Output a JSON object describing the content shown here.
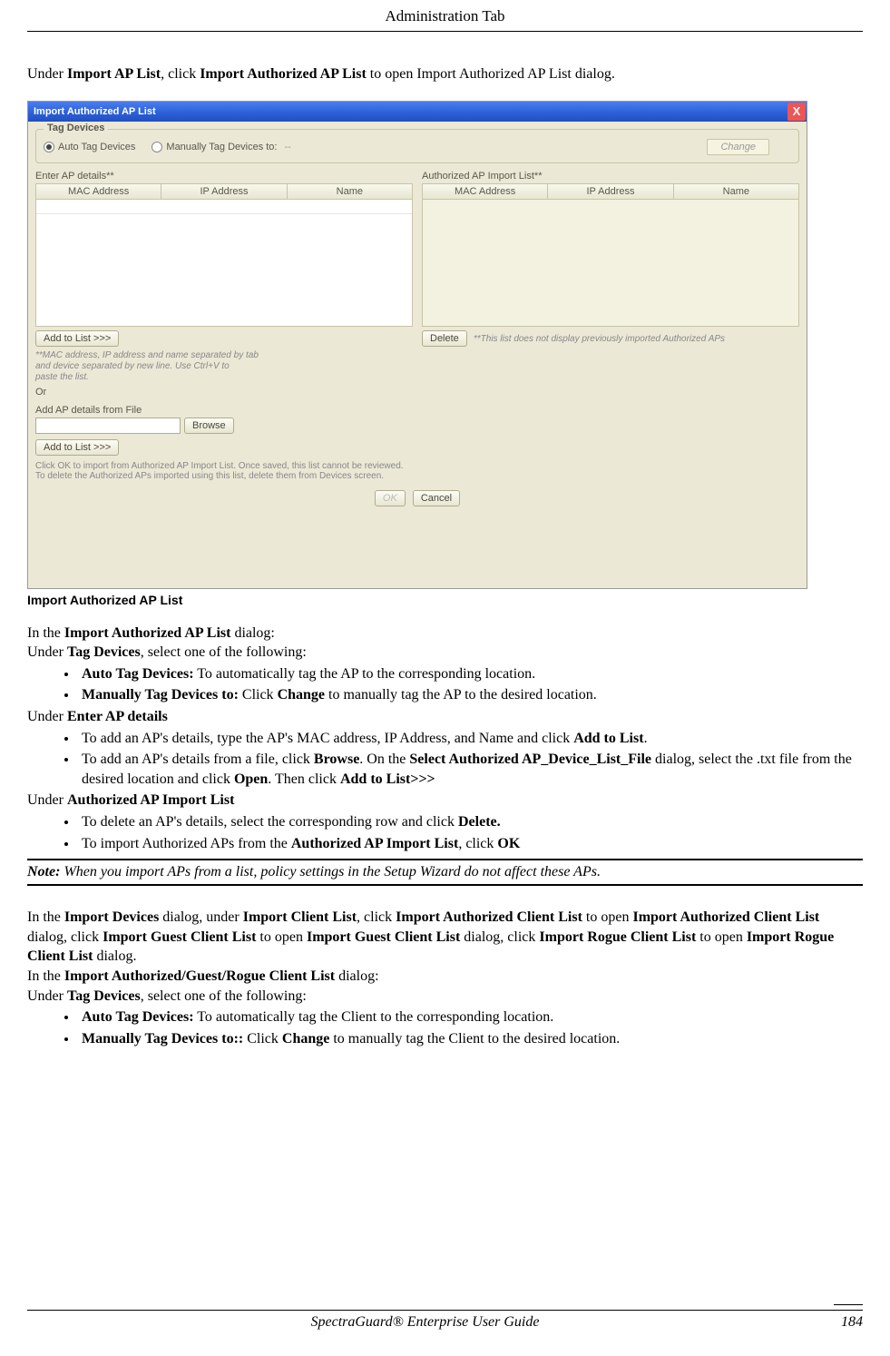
{
  "header": {
    "title": "Administration Tab"
  },
  "intro": {
    "p1a": "Under ",
    "p1b": "Import AP List",
    "p1c": ", click ",
    "p1d": "Import Authorized AP List",
    "p1e": " to open Import Authorized AP List dialog."
  },
  "dialog": {
    "title": "Import Authorized AP List",
    "tag_devices_legend": "Tag Devices",
    "auto_tag": "Auto Tag Devices",
    "manual_tag": "Manually Tag Devices to:",
    "manual_tag_val": "--",
    "change_btn": "Change",
    "enter_ap_label": "Enter AP details**",
    "authorized_list_label": "Authorized AP Import List**",
    "cols": {
      "mac": "MAC Address",
      "ip": "IP Address",
      "name": "Name"
    },
    "add_to_list": "Add to List >>>",
    "delete_btn": "Delete",
    "delete_hint": "**This list does not display previously imported Authorized APs",
    "mac_hint1": "**MAC address, IP address and name separated by tab",
    "mac_hint2": "and device separated by new line. Use Ctrl+V to",
    "mac_hint3": "paste the list.",
    "or_label": "Or",
    "add_from_file": "Add AP details from File",
    "browse": "Browse",
    "add_to_list2": "Add to List >>>",
    "bottom1": "Click OK to import from Authorized AP Import List. Once saved, this list cannot be reviewed.",
    "bottom2": "To delete the Authorized APs imported using this list, delete them from Devices screen.",
    "ok": "OK",
    "cancel": "Cancel"
  },
  "caption": "Import Authorized AP List",
  "body": {
    "l1a": "In the ",
    "l1b": "Import Authorized AP List",
    "l1c": " dialog:",
    "l2a": "Under ",
    "l2b": "Tag Devices",
    "l2c": ", select one of the following:",
    "b1a": "Auto Tag Devices:",
    "b1b": " To automatically tag the AP to the corresponding location.",
    "b2a": "Manually Tag Devices to:",
    "b2b": " Click ",
    "b2c": "Change",
    "b2d": " to manually tag the AP to the desired location.",
    "l3a": "Under ",
    "l3b": "Enter AP details",
    "b3a": "To add an AP's details, type the AP's MAC address, IP Address, and Name and click ",
    "b3b": "Add to List",
    "b3c": ".",
    "b4a": "To add an AP's details from a file, click ",
    "b4b": "Browse",
    "b4c": ". On the ",
    "b4d": "Select Authorized AP_Device_List_File",
    "b4e": " dialog, select the .txt file from the desired location and click ",
    "b4f": "Open",
    "b4g": ". Then click ",
    "b4h": "Add to List>>>",
    "l4a": "Under ",
    "l4b": "Authorized AP Import List",
    "b5a": "To delete an AP's details, select the corresponding row and click ",
    "b5b": "Delete.",
    "b6a": "To import Authorized APs from the ",
    "b6b": "Authorized AP Import List",
    "b6c": ", click ",
    "b6d": "OK"
  },
  "note": {
    "label": "Note:",
    "text": " When you import APs from a list, policy settings in the Setup Wizard do not affect these APs."
  },
  "body2": {
    "p1a": "In the ",
    "p1b": "Import Devices",
    "p1c": " dialog, under ",
    "p1d": "Import Client List",
    "p1e": ", click ",
    "p1f": "Import Authorized Client List",
    "p1g": " to open ",
    "p1h": "Import Authorized Client List",
    "p1i": " dialog, click ",
    "p1j": "Import Guest Client List",
    "p1k": " to open ",
    "p1l": "Import Guest Client List",
    "p1m": " dialog, click ",
    "p1n": "Import Rogue Client List",
    "p1o": " to open ",
    "p1p": "Import Rogue Client List",
    "p1q": " dialog.",
    "l1a": "In the ",
    "l1b": "Import Authorized/Guest/Rogue Client List",
    "l1c": " dialog:",
    "l2a": "Under ",
    "l2b": "Tag Devices",
    "l2c": ", select one of the following:",
    "b1a": "Auto Tag Devices:",
    "b1b": " To automatically tag the Client to the corresponding location.",
    "b2a": "Manually Tag Devices to::",
    "b2b": " Click ",
    "b2c": "Change",
    "b2d": " to manually tag the Client to the desired location."
  },
  "footer": {
    "center": "SpectraGuard®  Enterprise User Guide",
    "page": "184"
  }
}
